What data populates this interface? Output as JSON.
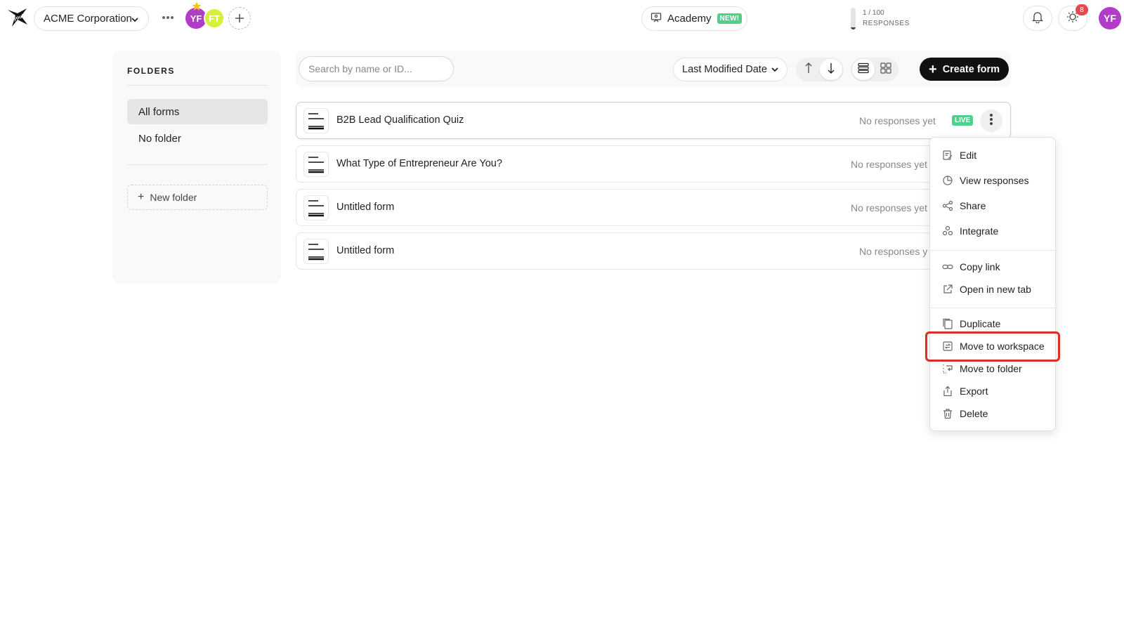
{
  "header": {
    "workspace": "ACME Corporation",
    "members": [
      "YF",
      "FT"
    ],
    "academy": {
      "label": "Academy",
      "badge": "NEW!"
    },
    "usage": {
      "count": "1 / 100",
      "unit": "RESPONSES",
      "fraction": 0.01
    },
    "notifications": "8",
    "user_initials": "YF",
    "colors": {
      "member_yf": "#b13cc7",
      "member_ft": "#d9ef3e",
      "badge_green": "#4fd18b",
      "notif_red": "#e5484d"
    }
  },
  "sidebar": {
    "heading": "FOLDERS",
    "items": [
      {
        "label": "All forms",
        "active": true
      },
      {
        "label": "No folder",
        "active": false
      }
    ],
    "new_folder": "New folder"
  },
  "toolbar": {
    "search_placeholder": "Search by name or ID...",
    "sort_label": "Last Modified Date",
    "create_label": "Create form"
  },
  "forms": [
    {
      "name": "B2B Lead Qualification Quiz",
      "responses": "No responses yet",
      "status": "LIVE"
    },
    {
      "name": "What Type of Entrepreneur Are You?",
      "responses": "No responses yet"
    },
    {
      "name": "Untitled form",
      "responses": "No responses yet"
    },
    {
      "name": "Untitled form",
      "responses": "No responses y"
    }
  ],
  "menu": {
    "items": [
      {
        "label": "Edit",
        "icon": "edit-icon"
      },
      {
        "label": "View responses",
        "icon": "chart-icon"
      },
      {
        "label": "Share",
        "icon": "share-icon"
      },
      {
        "label": "Integrate",
        "icon": "integrate-icon"
      },
      {
        "label": "Copy link",
        "icon": "link-icon"
      },
      {
        "label": "Open in new tab",
        "icon": "external-link-icon"
      },
      {
        "label": "Duplicate",
        "icon": "duplicate-icon"
      },
      {
        "label": "Move to workspace",
        "icon": "move-workspace-icon",
        "highlighted": true
      },
      {
        "label": "Move to folder",
        "icon": "move-folder-icon"
      },
      {
        "label": "Export",
        "icon": "export-icon"
      },
      {
        "label": "Delete",
        "icon": "trash-icon"
      }
    ],
    "highlight_color": "#d93025"
  }
}
